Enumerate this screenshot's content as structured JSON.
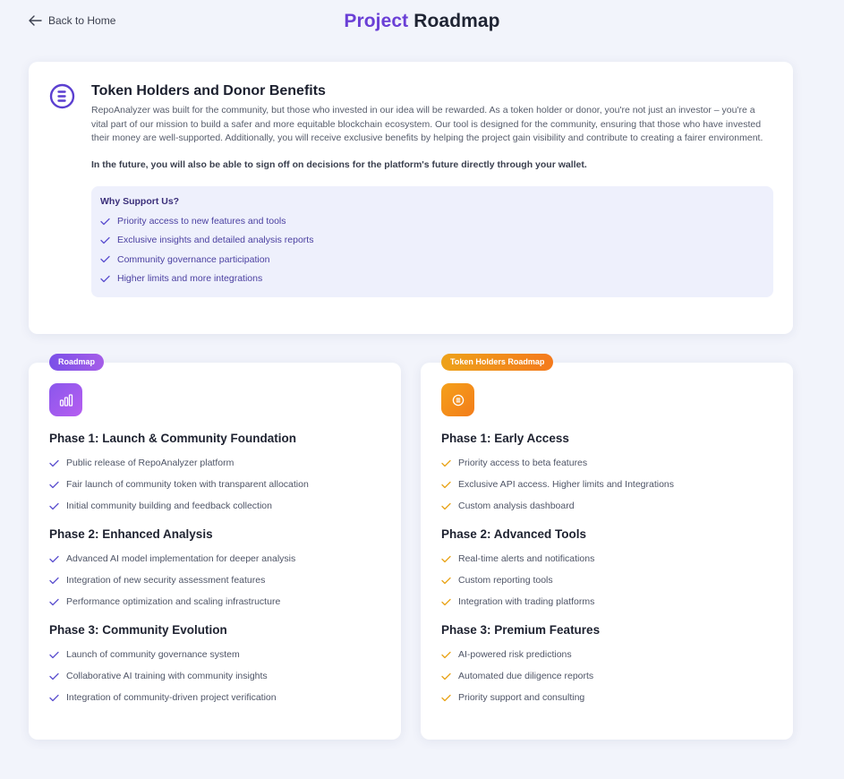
{
  "nav": {
    "back_label": "Back to Home"
  },
  "header": {
    "title_accent": "Project",
    "title_rest": "Roadmap"
  },
  "benefits": {
    "title": "Token Holders and Donor Benefits",
    "description": "RepoAnalyzer was built for the community, but those who invested in our idea will be rewarded. As a token holder or donor, you're not just an investor – you're a vital part of our mission to build a safer and more equitable blockchain ecosystem. Our tool is designed for the community, ensuring that those who have invested their money are well-supported. Additionally, you will receive exclusive benefits by helping the project gain visibility and contribute to creating a fairer environment.",
    "note": "In the future, you will also be able to sign off on decisions for the platform's future directly through your wallet.",
    "support": {
      "title": "Why Support Us?",
      "items": [
        "Priority access to new features and tools",
        "Exclusive insights and detailed analysis reports",
        "Community governance participation",
        "Higher limits and more integrations"
      ]
    }
  },
  "roadmap": {
    "badge": "Roadmap",
    "icon": "bar-chart-icon",
    "phases": [
      {
        "title": "Phase 1: Launch & Community Foundation",
        "items": [
          "Public release of RepoAnalyzer platform",
          "Fair launch of community token with transparent allocation",
          "Initial community building and feedback collection"
        ]
      },
      {
        "title": "Phase 2: Enhanced Analysis",
        "items": [
          "Advanced AI model implementation for deeper analysis",
          "Integration of new security assessment features",
          "Performance optimization and scaling infrastructure"
        ]
      },
      {
        "title": "Phase 3: Community Evolution",
        "items": [
          "Launch of community governance system",
          "Collaborative AI training with community insights",
          "Integration of community-driven project verification"
        ]
      }
    ]
  },
  "token_roadmap": {
    "badge": "Token Holders Roadmap",
    "icon": "token-icon",
    "phases": [
      {
        "title": "Phase 1: Early Access",
        "items": [
          "Priority access to beta features",
          "Exclusive API access. Higher limits and Integrations",
          "Custom analysis dashboard"
        ]
      },
      {
        "title": "Phase 2: Advanced Tools",
        "items": [
          "Real-time alerts and notifications",
          "Custom reporting tools",
          "Integration with trading platforms"
        ]
      },
      {
        "title": "Phase 3: Premium Features",
        "items": [
          "AI-powered risk predictions",
          "Automated due diligence reports",
          "Priority support and consulting"
        ]
      }
    ]
  },
  "colors": {
    "accent_purple": "#6a3fd6",
    "accent_orange": "#f08a1b",
    "check_purple": "#5b4fcf",
    "check_orange": "#e8a317"
  }
}
